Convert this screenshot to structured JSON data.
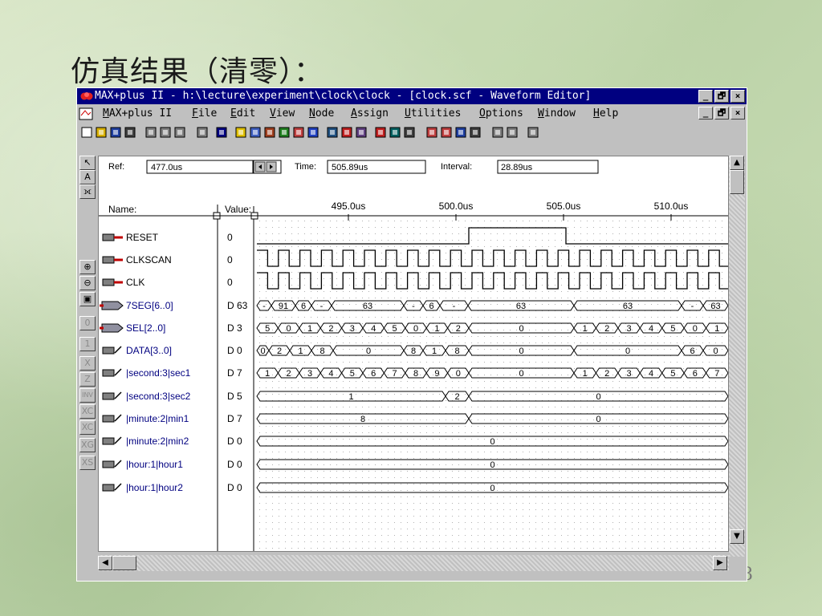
{
  "slide": {
    "title": "仿真结果（清零）：",
    "page_number": "8"
  },
  "window": {
    "title": "MAX+plus II - h:\\lecture\\experiment\\clock\\clock - [clock.scf - Waveform Editor]",
    "controls": [
      "_",
      "🗗",
      "×"
    ]
  },
  "menu": [
    "MAX+plus II",
    "File",
    "Edit",
    "View",
    "Node",
    "Assign",
    "Utilities",
    "Options",
    "Window",
    "Help"
  ],
  "toolbar_icons": [
    "new-icon",
    "open-icon",
    "save-icon",
    "print-icon",
    "cut-icon",
    "copy-icon",
    "paste-icon",
    "undo-icon",
    "help-icon",
    "warning-icon",
    "hierarchy-icon",
    "floorplan-icon",
    "symbol-icon",
    "text-icon",
    "waveform-icon",
    "compile-icon",
    "simulate-icon",
    "timing-icon",
    "programmer-icon",
    "project-icon",
    "save-check-icon",
    "save-compile-icon",
    "save-simulate-icon",
    "probe-icon",
    "probe-sim-icon",
    "probe-timing-icon",
    "probe-prog-icon",
    "grid-icon",
    "grid2-icon",
    "zoom-icon"
  ],
  "header": {
    "ref_label": "Ref:",
    "ref_value": "477.0us",
    "time_label": "Time:",
    "time_value": "505.89us",
    "interval_label": "Interval:",
    "interval_value": "28.89us",
    "name_label": "Name:",
    "value_label": "Value:"
  },
  "timeline": {
    "labels": [
      "495.0us",
      "500.0us",
      "505.0us",
      "510.0us"
    ]
  },
  "signals": [
    {
      "name": "RESET",
      "value": "0",
      "type": "input"
    },
    {
      "name": "CLKSCAN",
      "value": "0",
      "type": "input"
    },
    {
      "name": "CLK",
      "value": "0",
      "type": "input"
    },
    {
      "name": "7SEG[6..0]",
      "value": "D 63",
      "type": "bus-output"
    },
    {
      "name": "SEL[2..0]",
      "value": "D 3",
      "type": "bus-output"
    },
    {
      "name": "DATA[3..0]",
      "value": "D 0",
      "type": "buried"
    },
    {
      "name": "|second:3|sec1",
      "value": "D 7",
      "type": "buried"
    },
    {
      "name": "|second:3|sec2",
      "value": "D 5",
      "type": "buried"
    },
    {
      "name": "|minute:2|min1",
      "value": "D 7",
      "type": "buried"
    },
    {
      "name": "|minute:2|min2",
      "value": "D 0",
      "type": "buried"
    },
    {
      "name": "|hour:1|hour1",
      "value": "D 0",
      "type": "buried"
    },
    {
      "name": "|hour:1|hour2",
      "value": "D 0",
      "type": "buried"
    }
  ],
  "bus_values": {
    "seg7": [
      "-",
      "91",
      "6",
      "-",
      "63",
      "-",
      "6",
      "-",
      "63",
      "63",
      "-",
      "63"
    ],
    "sel": [
      "5",
      "0",
      "1",
      "2",
      "3",
      "4",
      "5",
      "0",
      "1",
      "2",
      "0",
      "1",
      "2",
      "3",
      "4",
      "5",
      "0",
      "1"
    ],
    "data": [
      "0",
      "2",
      "1",
      "8",
      "0",
      "8",
      "1",
      "8",
      "0",
      "0",
      "6",
      "0"
    ],
    "sec1": [
      "1",
      "2",
      "3",
      "4",
      "5",
      "6",
      "7",
      "8",
      "9",
      "0",
      "0",
      "1",
      "2",
      "3",
      "4",
      "5",
      "6",
      "7"
    ],
    "sec2": [
      "1",
      "2",
      "0"
    ],
    "min1": [
      "8",
      "0"
    ],
    "min2": [
      "0"
    ],
    "hour1": [
      "0"
    ],
    "hour2": [
      "0"
    ]
  },
  "left_tools": [
    "pointer-icon",
    "text-tool-icon",
    "node-icon",
    "zoom-in-icon",
    "zoom-out-icon",
    "fit-icon",
    "set-0-icon",
    "set-1-icon",
    "set-x-icon",
    "set-z-icon",
    "invert-icon",
    "overwrite-clock-icon",
    "overwrite-count-icon",
    "overwrite-group-icon",
    "overwrite-value-icon"
  ]
}
